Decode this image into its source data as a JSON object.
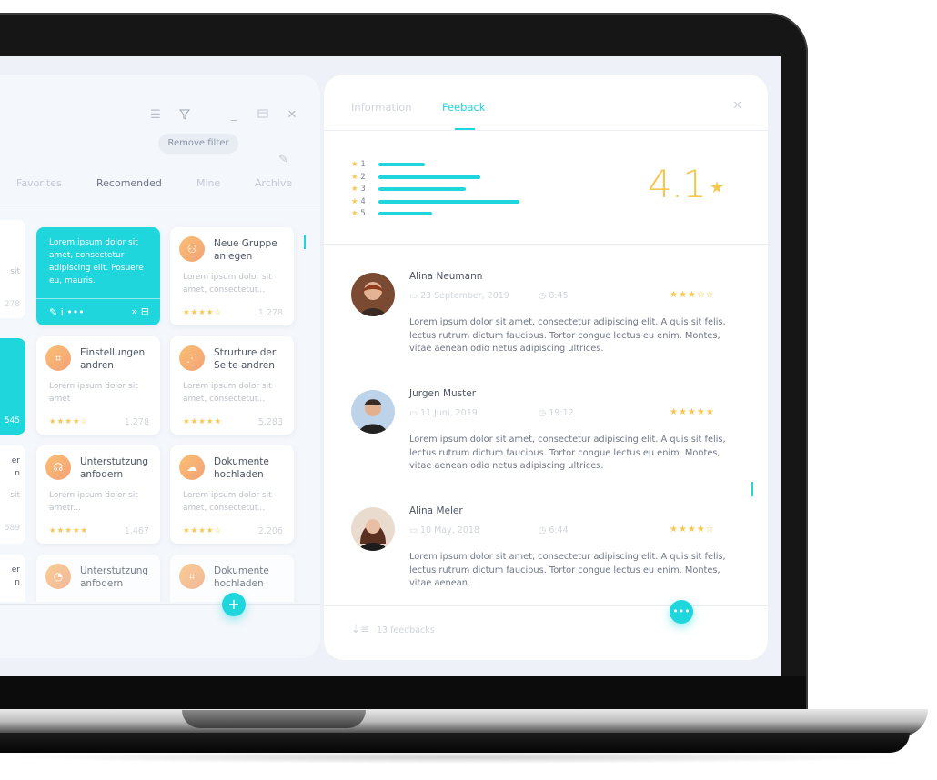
{
  "toolbar": {
    "remove_filter_label": "Remove filter",
    "icons": [
      "list-icon",
      "filter-icon",
      "minimize-icon",
      "maximize-icon",
      "close-icon"
    ]
  },
  "tabs": [
    "Favorites",
    "Recomended",
    "Mine",
    "Archive"
  ],
  "active_tab": "Recomended",
  "cards": [
    {
      "title": "Neue Gruppe anlegen",
      "desc": "Lorem ipsum dolor sit amet, consectetur...",
      "stars": "★★★★☆",
      "count": "1.278"
    },
    {
      "title": "Einstellungen andren",
      "desc": "Lorem ipsum dolor sit amet",
      "stars": "★★★★☆",
      "count": "1.278"
    },
    {
      "title": "Strurture der Seite andren",
      "desc": "Lorem ipsum dolor sit amet, consectetur...",
      "stars": "★★★★★",
      "count": "5.283"
    },
    {
      "title": "Unterstutzung anfodern",
      "desc": "Lorem ipsum dolor sit ametr...",
      "stars": "★★★★★",
      "count": "1.467"
    },
    {
      "title": "Dokumente hochladen",
      "desc": "Lorem ipsum dolor sit amet, consectetur...",
      "stars": "★★★★☆",
      "count": "2.206"
    },
    {
      "title": "Unterstutzung anfodern"
    },
    {
      "title": "Dokumente hochladen"
    }
  ],
  "teal_card": {
    "desc": "Lorem ipsum dolor sit amet, consectetur adipiscing elit. Posuere eu, mauris.",
    "actions": "✎  i  •••"
  },
  "partial": {
    "a": "sit",
    "b": "278",
    "c": "545",
    "d1": "er",
    "d2": "n",
    "d3": "sit",
    "d4": "589",
    "e1": "er",
    "e2": "n"
  },
  "right": {
    "tab_info": "Information",
    "tab_feedback": "Feeback",
    "rating": "4.1",
    "bars": [
      {
        "label": "1",
        "value": 0.33
      },
      {
        "label": "2",
        "value": 0.72
      },
      {
        "label": "3",
        "value": 0.62
      },
      {
        "label": "4",
        "value": 1.0
      },
      {
        "label": "5",
        "value": 0.38
      }
    ],
    "reviews": [
      {
        "name": "Alina Neumann",
        "date": "23 September, 2019",
        "time": "8:45",
        "stars": "★★★☆☆",
        "text": "Lorem ipsum dolor sit amet, consectetur adipiscing elit. A quis sit felis, lectus rutrum dictum faucibus. Tortor congue lectus eu enim. Montes, vitae aenean odio netus adipiscing ultrices."
      },
      {
        "name": "Jurgen Muster",
        "date": "11 Juni, 2019",
        "time": "19:12",
        "stars": "★★★★★",
        "text": "Lorem ipsum dolor sit amet, consectetur adipiscing elit. A quis sit felis, lectus rutrum dictum faucibus. Tortor congue lectus eu enim. Montes, vitae aenean odio netus adipiscing ultrices."
      },
      {
        "name": "Alina Meler",
        "date": "10 May, 2018",
        "time": "6:44",
        "stars": "★★★★☆",
        "text": "Lorem ipsum dolor sit amet, consectetur adipiscing elit. A quis sit felis, lectus rutrum dictum faucibus. Tortor congue lectus eu enim. Montes, vitae aenean."
      }
    ],
    "footer": "13 feedbacks"
  }
}
